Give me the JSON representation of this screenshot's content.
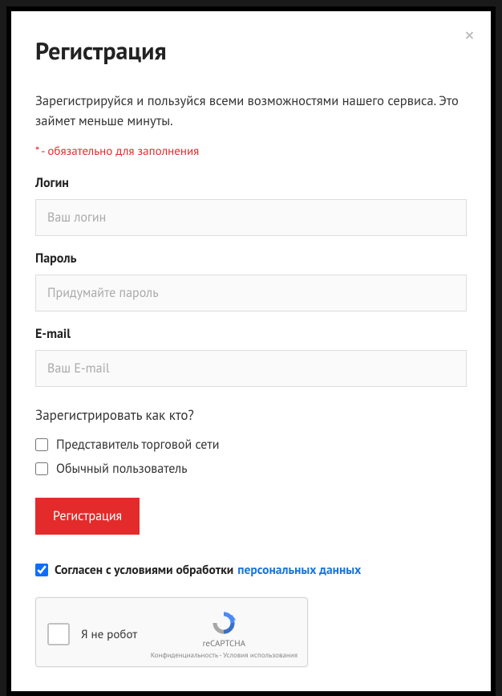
{
  "modal": {
    "title": "Регистрация",
    "lead": "Зарегистрируйся и пользуйся всеми возможностями нашего сервиса. Это займет меньше минуты.",
    "required_note": "* - обязательно для заполнения",
    "close_symbol": "×"
  },
  "form": {
    "login": {
      "label": "Логин",
      "placeholder": "Ваш логин",
      "value": ""
    },
    "password": {
      "label": "Пароль",
      "placeholder": "Придумайте пароль",
      "value": ""
    },
    "email": {
      "label": "E-mail",
      "placeholder": "Ваш E-mail",
      "value": ""
    },
    "role_question": "Зарегистрировать как кто?",
    "role_options": [
      {
        "label": "Представитель торговой сети",
        "checked": false
      },
      {
        "label": "Обычный пользователь",
        "checked": false
      }
    ],
    "submit_label": "Регистрация"
  },
  "consent": {
    "checked": true,
    "text_prefix": "Согласен с условиями обработки",
    "link_text": "персональных данных"
  },
  "recaptcha": {
    "label": "Я не робот",
    "brand": "reCAPTCHA",
    "privacy": "Конфиденциальность",
    "terms": "Условия использования",
    "separator": " - "
  }
}
